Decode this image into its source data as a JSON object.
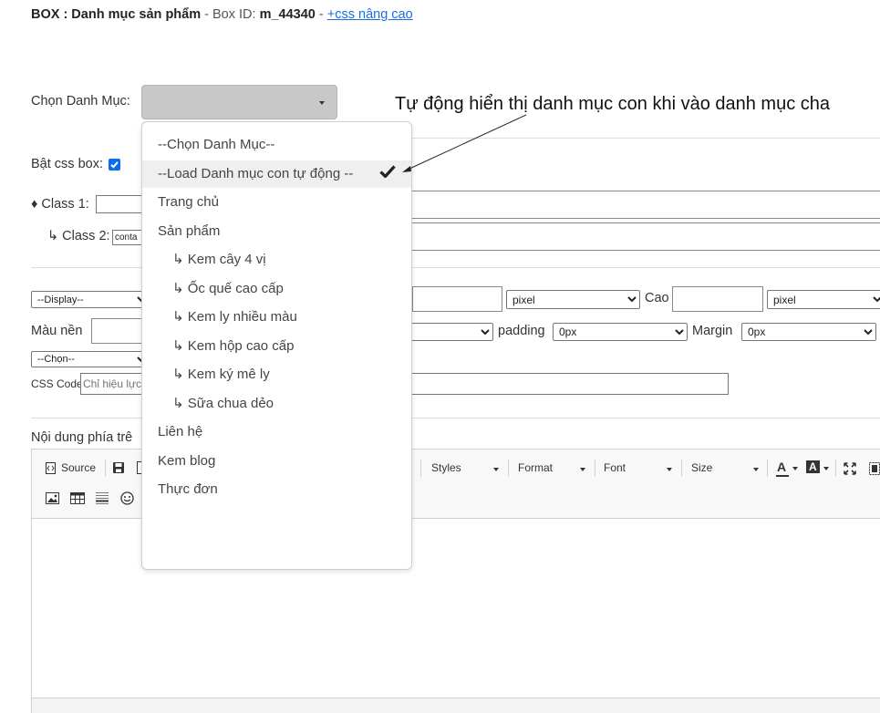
{
  "header": {
    "title": "BOX : Danh mục sản phẩm",
    "box_id_sep": " - Box ID: ",
    "box_id": "m_44340",
    "sep2": " - ",
    "advanced_link": "+css nâng cao"
  },
  "category": {
    "label": "Chọn Danh Mục:",
    "selected": ""
  },
  "css_box": {
    "label": "Bật css box:",
    "checked": true
  },
  "class1": {
    "label": "♦ Class 1:",
    "value": ""
  },
  "class2": {
    "label": "↳ Class 2:",
    "value": "conta"
  },
  "display": {
    "value": "--Display--"
  },
  "width_unit": "pixel",
  "height": {
    "label": "Cao",
    "unit": "pixel"
  },
  "bg_color": {
    "label": "Màu nền"
  },
  "padding": {
    "label": "padding",
    "value": "0px"
  },
  "margin": {
    "label": "Margin",
    "value": "0px"
  },
  "choose": {
    "value": "--Chọn--"
  },
  "css_code": {
    "label": "CSS Code",
    "placeholder": "Chỉ hiệu lực"
  },
  "content_label": "Nội dung phía trê",
  "toolbar": {
    "source": "Source",
    "styles": "Styles",
    "format": "Format",
    "font": "Font",
    "size": "Size",
    "text_color": "A",
    "bg_color_btn": "A"
  },
  "dropdown": {
    "items": [
      {
        "label": "--Chọn Danh Mục--",
        "level": 0
      },
      {
        "label": "--Load Danh mục con tự động --",
        "level": 0,
        "highlighted": true
      },
      {
        "label": "Trang chủ",
        "level": 0
      },
      {
        "label": "Sản phẩm",
        "level": 0
      },
      {
        "label": "↳ Kem cây 4 vị",
        "level": 1
      },
      {
        "label": "↳ Ốc quế cao cấp",
        "level": 1
      },
      {
        "label": "↳ Kem ly nhiều màu",
        "level": 1
      },
      {
        "label": "↳ Kem hộp cao cấp",
        "level": 1
      },
      {
        "label": "↳ Kem ký mê ly",
        "level": 1
      },
      {
        "label": "↳ Sữa chua dẻo",
        "level": 1
      },
      {
        "label": "Liên hệ",
        "level": 0
      },
      {
        "label": "Kem blog",
        "level": 0
      },
      {
        "label": "Thực đơn",
        "level": 0
      }
    ]
  },
  "annotation": "Tự động hiển thị danh mục con khi vào danh mục cha",
  "icons": [
    "checkmark-icon",
    "arrow-icon",
    "save-icon",
    "image-icon",
    "table-icon",
    "horizontal-rule-icon",
    "smiley-icon",
    "maximize-icon",
    "show-blocks-icon"
  ]
}
